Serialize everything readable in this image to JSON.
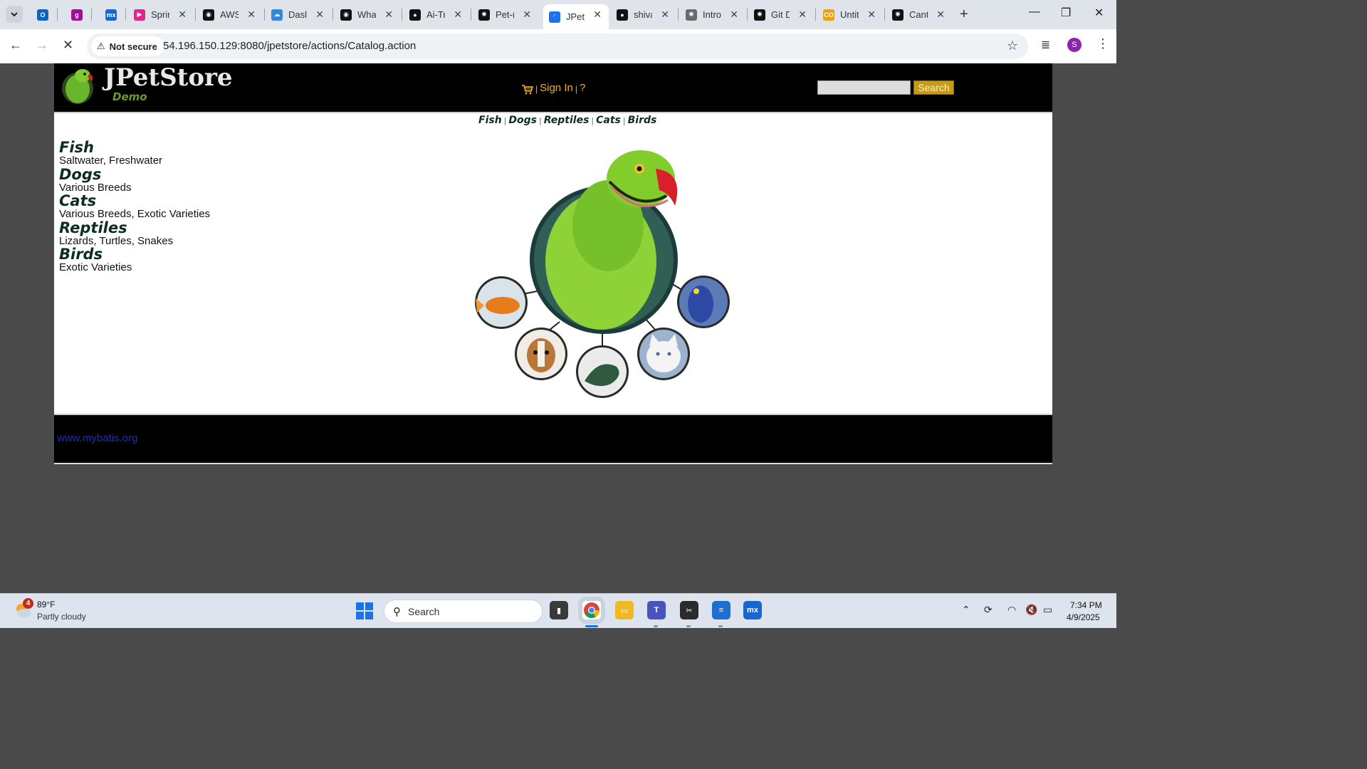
{
  "browser": {
    "tabs": [
      {
        "title": "",
        "favicon": "outlook-icon",
        "color": "#0a64c2",
        "glyph": "O"
      },
      {
        "title": "",
        "favicon": "gmail-g-icon",
        "color": "#a30d9c",
        "glyph": "g"
      },
      {
        "title": "",
        "favicon": "mx-icon",
        "color": "#1667d0",
        "glyph": "mx"
      },
      {
        "title": "Sprir",
        "favicon": "streamlit-icon",
        "color": "#e0258f",
        "glyph": "▶"
      },
      {
        "title": "AWS",
        "favicon": "eye-icon",
        "color": "#111111",
        "glyph": "◉"
      },
      {
        "title": "Dasl",
        "favicon": "cloud-icon",
        "color": "#2c8be0",
        "glyph": "☁"
      },
      {
        "title": "Wha",
        "favicon": "eye-icon",
        "color": "#111111",
        "glyph": "◉"
      },
      {
        "title": "Ai-Tr",
        "favicon": "github-icon",
        "color": "#111111",
        "glyph": "●"
      },
      {
        "title": "Pet-(",
        "favicon": "chatgpt-icon",
        "color": "#111111",
        "glyph": "✺"
      },
      {
        "title": "JPet",
        "favicon": "loading-icon",
        "color": "#1a73e8",
        "glyph": "◜"
      },
      {
        "title": "shiva",
        "favicon": "github-icon",
        "color": "#111111",
        "glyph": "●"
      },
      {
        "title": "Intro",
        "favicon": "chatgpt-icon",
        "color": "#6a6a6a",
        "glyph": "✺"
      },
      {
        "title": "Git D",
        "favicon": "chatgpt-icon",
        "color": "#111111",
        "glyph": "✺"
      },
      {
        "title": "Untit",
        "favicon": "colab-icon",
        "color": "#f29d0c",
        "glyph": "CO"
      },
      {
        "title": "Cant",
        "favicon": "chatgpt-icon",
        "color": "#111111",
        "glyph": "✺"
      }
    ],
    "active_tab_index": 9,
    "security_label": "Not secure",
    "url": "54.196.150.129:8080/jpetstore/actions/Catalog.action",
    "profile_initial": "S"
  },
  "store": {
    "logo_title": "JPetStore",
    "logo_sub": "Demo",
    "sign_in": "Sign In",
    "help": "?",
    "pipe": "|",
    "search_button": "Search",
    "search_value": "",
    "quicklinks": [
      "Fish",
      "Dogs",
      "Reptiles",
      "Cats",
      "Birds"
    ],
    "categories": [
      {
        "name": "Fish",
        "desc": "Saltwater, Freshwater"
      },
      {
        "name": "Dogs",
        "desc": "Various Breeds"
      },
      {
        "name": "Cats",
        "desc": "Various Breeds, Exotic Varieties"
      },
      {
        "name": "Reptiles",
        "desc": "Lizards, Turtles, Snakes"
      },
      {
        "name": "Birds",
        "desc": "Exotic Varieties"
      }
    ],
    "footer_link": "www.mybatis.org"
  },
  "taskbar": {
    "weather_badge": "4",
    "weather_temp": "89°F",
    "weather_condition": "Partly cloudy",
    "search_label": "Search",
    "time": "7:34 PM",
    "date": "4/9/2025"
  }
}
